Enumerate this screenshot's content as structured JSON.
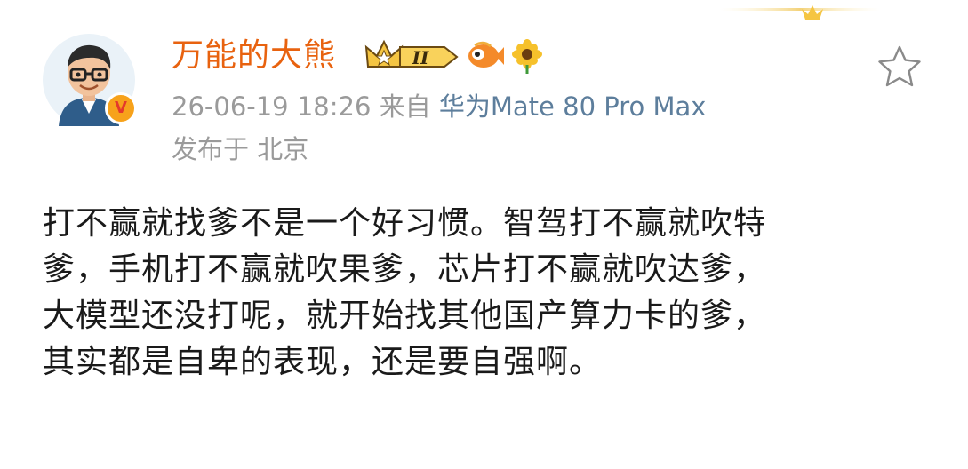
{
  "post": {
    "author": {
      "name": "万能的大熊",
      "level_badge": "II"
    },
    "meta": {
      "timestamp": "26-06-19 18:26",
      "source_prefix": "来自",
      "device": "华为Mate 80 Pro Max"
    },
    "location": "发布于 北京",
    "content_lines": [
      "打不赢就找爹不是一个好习惯。智驾打不赢就吹特",
      "爹，手机打不赢就吹果爹，芯片打不赢就吹达爹，",
      "大模型还没打呢，就开始找其他国产算力卡的爹，",
      "其实都是自卑的表现，还是要自强啊。"
    ]
  },
  "colors": {
    "username": "#e8620f",
    "meta_gray": "#9a9a9a",
    "device_link": "#5d7e9c",
    "body_text": "#1a1a1a",
    "verified": "#f7a21b"
  },
  "icons": {
    "verified": "verified-v-badge-icon",
    "crown": "crown-level-icon",
    "fish": "fish-badge-icon",
    "flower": "sunflower-badge-icon",
    "favorite": "star-outline-icon"
  }
}
